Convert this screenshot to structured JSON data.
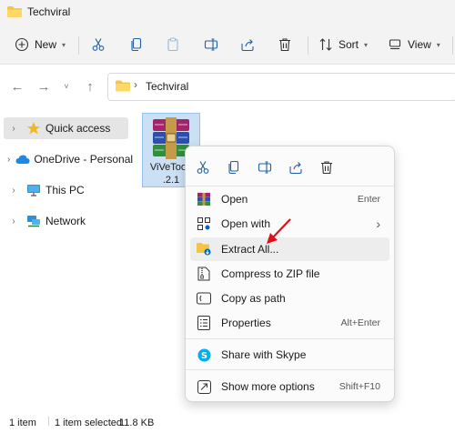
{
  "window": {
    "title": "Techviral"
  },
  "toolbar": {
    "new_label": "New",
    "sort_label": "Sort",
    "view_label": "View",
    "more_label": "···"
  },
  "address": {
    "path": "Techviral",
    "separator": "›"
  },
  "sidebar": {
    "items": [
      {
        "label": "Quick access"
      },
      {
        "label": "OneDrive - Personal"
      },
      {
        "label": "This PC"
      },
      {
        "label": "Network"
      }
    ]
  },
  "file": {
    "name_line1": "ViVeTool-",
    "name_line2": ".2.1"
  },
  "context_menu": {
    "items": [
      {
        "label": "Open",
        "shortcut": "Enter"
      },
      {
        "label": "Open with",
        "shortcut": "›"
      },
      {
        "label": "Extract All...",
        "shortcut": ""
      },
      {
        "label": "Compress to ZIP file",
        "shortcut": ""
      },
      {
        "label": "Copy as path",
        "shortcut": ""
      },
      {
        "label": "Properties",
        "shortcut": "Alt+Enter"
      },
      {
        "label": "Share with Skype",
        "shortcut": ""
      },
      {
        "label": "Show more options",
        "shortcut": "Shift+F10"
      }
    ]
  },
  "status": {
    "item_count": "1 item",
    "selected": "1 item selected",
    "size": "11.8 KB"
  },
  "colors": {
    "folder": "#f4c542",
    "accent": "#0067c0",
    "arrow": "#e0101a",
    "skype": "#00aff0"
  }
}
